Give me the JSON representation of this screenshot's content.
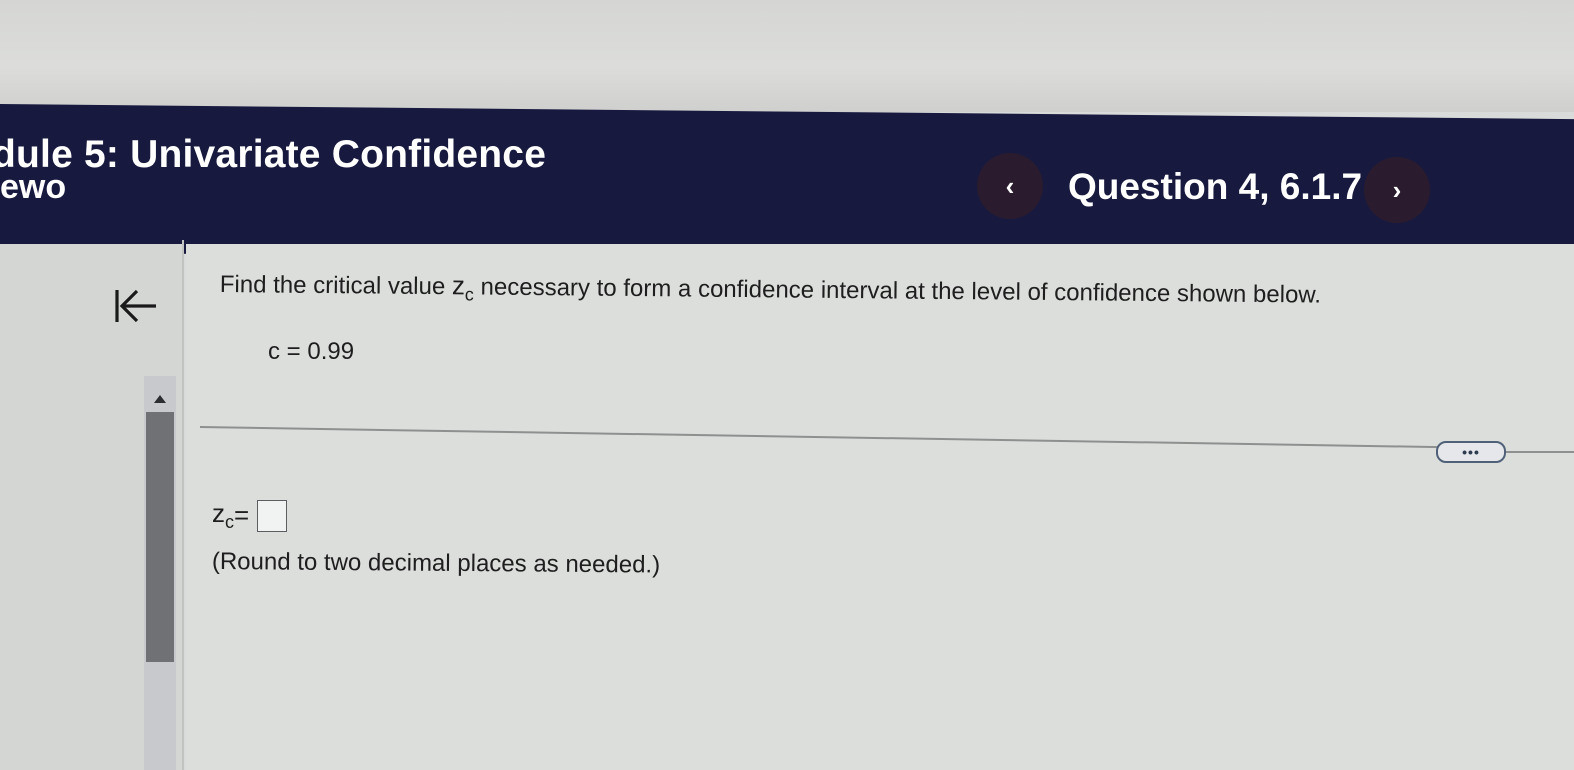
{
  "header": {
    "module_title": "dule 5: Univariate Confidence",
    "module_subtitle": "ewo",
    "question_label": "Question 4, 6.1.7",
    "prev_label": "‹",
    "next_label": "›"
  },
  "question": {
    "prompt_before": "Find the critical value ",
    "prompt_var": "z",
    "prompt_var_sub": "c",
    "prompt_after": " necessary to form a confidence interval at the level of confidence shown below.",
    "given": "c = 0.99"
  },
  "answer": {
    "var": "z",
    "var_sub": "c",
    "equals": " =",
    "value": "",
    "instruction": "(Round to two decimal places as needed.)"
  },
  "controls": {
    "more_label": "•••"
  },
  "icons": {
    "back": "back-to-start-icon",
    "scroll_up": "scroll-up-arrow-icon"
  },
  "colors": {
    "header_bg": "#18193f",
    "nav_button_bg": "#2a1c2e",
    "scroll_thumb": "#6f7174"
  }
}
